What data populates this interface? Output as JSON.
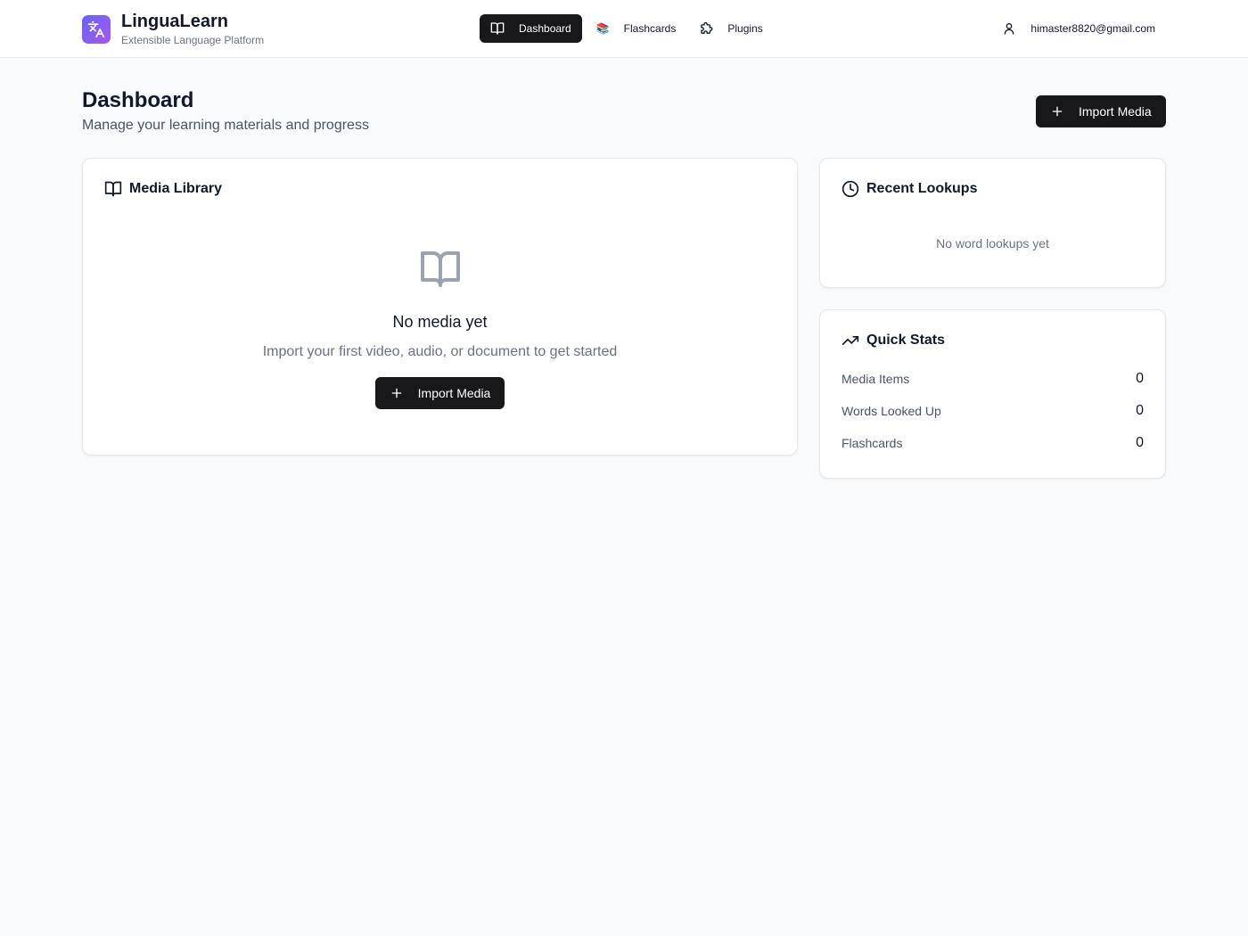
{
  "brand": {
    "title": "LinguaLearn",
    "subtitle": "Extensible Language Platform",
    "logo_icon": "translate-icon",
    "logo_gradient": [
      "#6366f1",
      "#a855f7"
    ]
  },
  "nav": {
    "items": [
      {
        "label": "Dashboard",
        "icon": "book-open-icon",
        "active": true
      },
      {
        "label": "Flashcards",
        "icon": "books-emoji",
        "glyph": "📚",
        "active": false
      },
      {
        "label": "Plugins",
        "icon": "puzzle-icon",
        "active": false
      }
    ]
  },
  "user": {
    "email": "himaster8820@gmail.com",
    "icon": "user-icon"
  },
  "page": {
    "title": "Dashboard",
    "subtitle": "Manage your learning materials and progress",
    "import_label": "Import Media"
  },
  "media_library": {
    "title": "Media Library",
    "empty_title": "No media yet",
    "empty_subtitle": "Import your first video, audio, or document to get started",
    "import_label": "Import Media"
  },
  "recent_lookups": {
    "title": "Recent Lookups",
    "empty_text": "No word lookups yet"
  },
  "quick_stats": {
    "title": "Quick Stats",
    "rows": [
      {
        "label": "Media Items",
        "value": "0"
      },
      {
        "label": "Words Looked Up",
        "value": "0"
      },
      {
        "label": "Flashcards",
        "value": "0"
      }
    ]
  },
  "colors": {
    "accent_dark": "#18181b",
    "background": "#f9fafb",
    "muted_text": "#6b7280"
  }
}
